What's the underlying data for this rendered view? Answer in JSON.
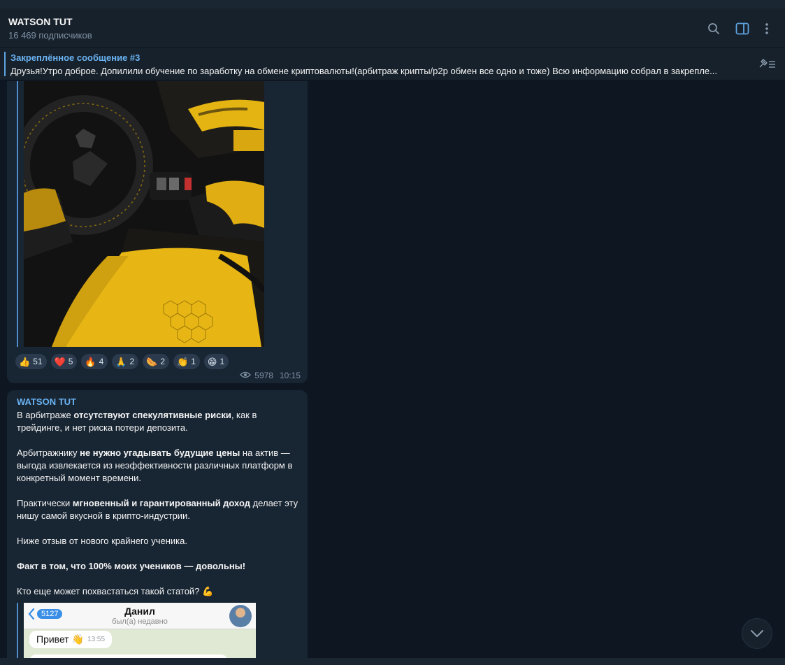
{
  "header": {
    "title": "WATSON TUT",
    "subscribers": "16 469 подписчиков",
    "icons": [
      "search-icon",
      "sidebar-toggle-icon",
      "more-vertical-icon"
    ]
  },
  "pinned": {
    "title": "Закреплённое сообщение #3",
    "text": "Друзья!Утро доброе. Допилили обучение по заработку на обмене криптовалюты!(арбитраж крипты/p2p обмен все одно и тоже) Всю информацию собрал в закрепле...",
    "icon": "unpin-icon"
  },
  "post1": {
    "reactions": [
      {
        "emoji": "👍",
        "count": "51"
      },
      {
        "emoji": "❤️",
        "count": "5"
      },
      {
        "emoji": "🔥",
        "count": "4"
      },
      {
        "emoji": "🙏",
        "count": "2"
      },
      {
        "emoji": "🌭",
        "count": "2"
      },
      {
        "emoji": "👏",
        "count": "1"
      },
      {
        "emoji": "😁",
        "count": "1"
      }
    ],
    "views": "5978",
    "time": "10:15"
  },
  "post2": {
    "author": "WATSON TUT",
    "p1_a": "В арбитраже ",
    "p1_b": "отсутствуют спекулятивные риски",
    "p1_c": ", как в трейдинге, и нет риска потери депозита.",
    "p2_a": "Арбитражнику ",
    "p2_b": "не нужно угадывать будущие цены",
    "p2_c": " на актив — выгода извлекается из неэффективности различных платформ в конкретный момент времени.",
    "p3_a": "Практически ",
    "p3_b": "мгновенный и гарантированный доход",
    "p3_c": " делает эту нишу самой вкусной в крипто-индустрии.",
    "p4": "Ниже отзыв от нового крайнего ученика.",
    "p5": "Факт в том, что 100% моих учеников — довольны!",
    "p6": "Кто еще может похвастаться такой статой? 💪",
    "screenshot": {
      "back_count": "5127",
      "contact_name": "Данил",
      "last_seen": "был(а) недавно",
      "message": "Привет 👋",
      "message_time": "13:55"
    }
  },
  "colors": {
    "background": "#0e1621",
    "header": "#17212b",
    "bubble": "#182533",
    "accent": "#6ab3f3"
  }
}
